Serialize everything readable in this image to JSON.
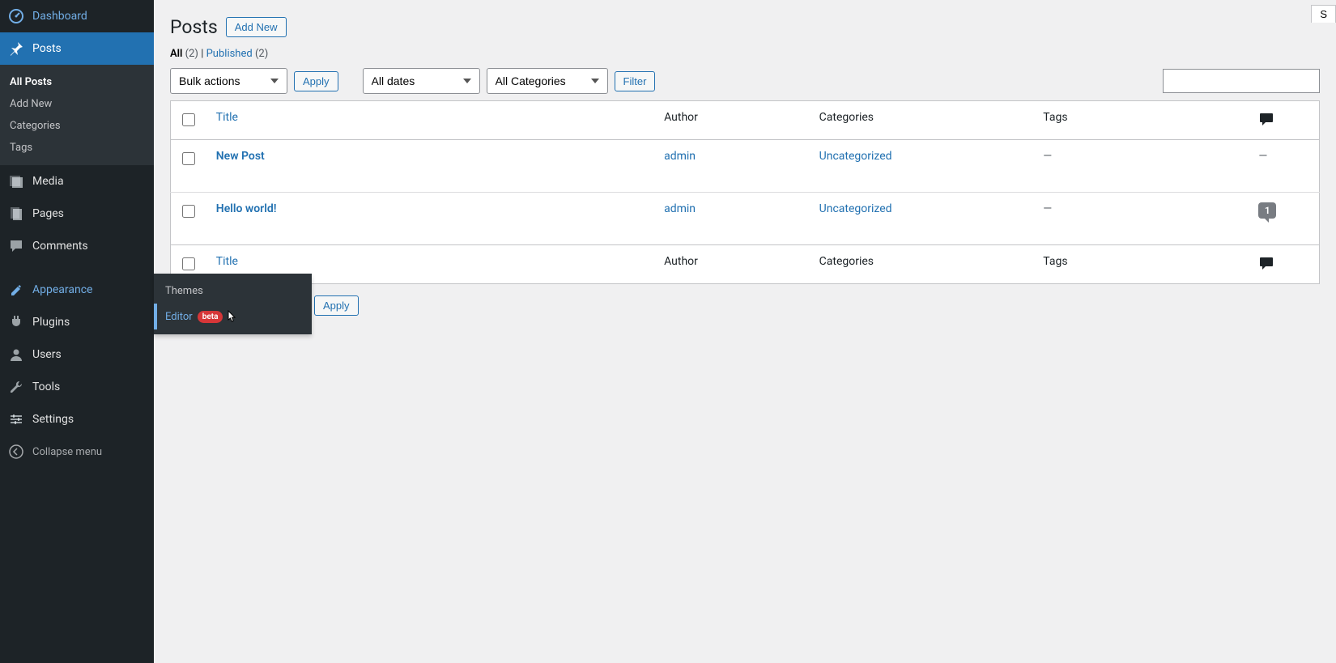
{
  "sidebar": {
    "dashboard": "Dashboard",
    "posts": "Posts",
    "posts_sub": {
      "all": "All Posts",
      "add": "Add New",
      "cat": "Categories",
      "tags": "Tags"
    },
    "media": "Media",
    "pages": "Pages",
    "comments": "Comments",
    "appearance": "Appearance",
    "plugins": "Plugins",
    "users": "Users",
    "tools": "Tools",
    "settings": "Settings",
    "collapse": "Collapse menu"
  },
  "flyout": {
    "themes": "Themes",
    "editor": "Editor",
    "beta": "beta"
  },
  "header": {
    "title": "Posts",
    "add_new": "Add New",
    "screen_options": "S"
  },
  "views": {
    "all_label": "All",
    "all_count": "(2)",
    "pub_label": "Published",
    "pub_count": "(2)",
    "sep": " | "
  },
  "filters": {
    "bulk": "Bulk actions",
    "apply": "Apply",
    "dates": "All dates",
    "cats": "All Categories",
    "filter": "Filter"
  },
  "columns": {
    "title": "Title",
    "author": "Author",
    "categories": "Categories",
    "tags": "Tags"
  },
  "rows": [
    {
      "title": "New Post",
      "author": "admin",
      "category": "Uncategorized",
      "tags": "—",
      "comments": 0
    },
    {
      "title": "Hello world!",
      "author": "admin",
      "category": "Uncategorized",
      "tags": "—",
      "comments": 1
    }
  ]
}
